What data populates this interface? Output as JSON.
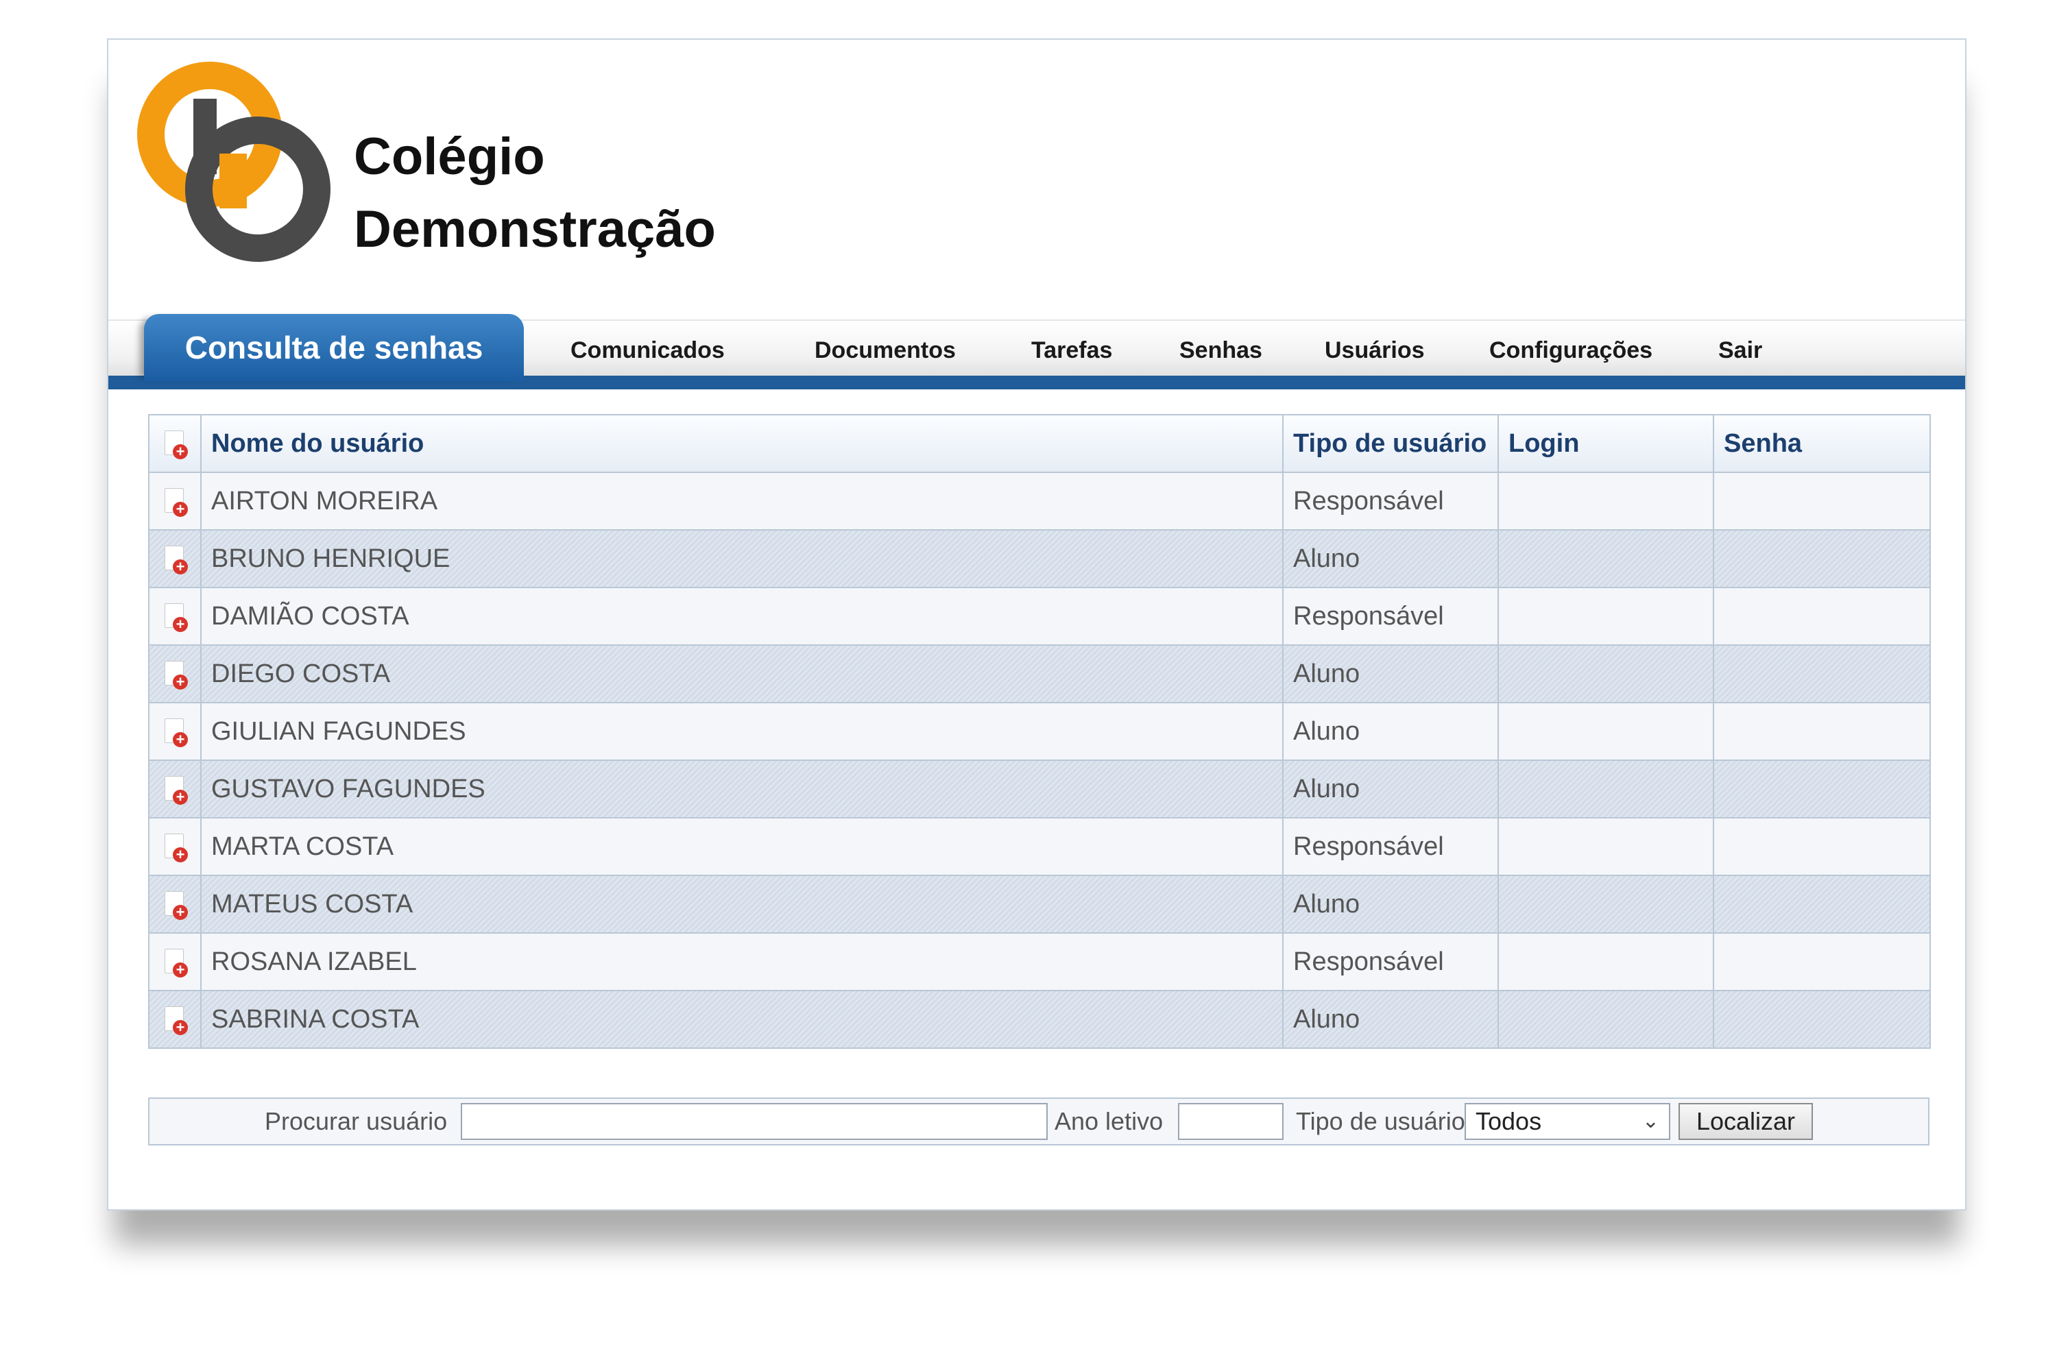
{
  "brand": {
    "line1": "Colégio",
    "line2": "Demonstração"
  },
  "nav": {
    "active": "Consulta de senhas",
    "items": [
      "Comunicados",
      "Documentos",
      "Tarefas",
      "Senhas",
      "Usuários",
      "Configurações",
      "Sair"
    ]
  },
  "table": {
    "headers": [
      "Nome do usuário",
      "Tipo de usuário",
      "Login",
      "Senha"
    ],
    "rows": [
      {
        "name": "AIRTON MOREIRA",
        "type": "Responsável",
        "login": "",
        "senha": ""
      },
      {
        "name": "BRUNO HENRIQUE",
        "type": "Aluno",
        "login": "",
        "senha": ""
      },
      {
        "name": "DAMIÃO COSTA",
        "type": "Responsável",
        "login": "",
        "senha": ""
      },
      {
        "name": "DIEGO COSTA",
        "type": "Aluno",
        "login": "",
        "senha": ""
      },
      {
        "name": "GIULIAN FAGUNDES",
        "type": "Aluno",
        "login": "",
        "senha": ""
      },
      {
        "name": "GUSTAVO FAGUNDES",
        "type": "Aluno",
        "login": "",
        "senha": ""
      },
      {
        "name": "MARTA COSTA",
        "type": "Responsável",
        "login": "",
        "senha": ""
      },
      {
        "name": "MATEUS COSTA",
        "type": "Aluno",
        "login": "",
        "senha": ""
      },
      {
        "name": "ROSANA IZABEL",
        "type": "Responsável",
        "login": "",
        "senha": ""
      },
      {
        "name": "SABRINA COSTA",
        "type": "Aluno",
        "login": "",
        "senha": ""
      }
    ]
  },
  "search": {
    "user_label": "Procurar usuário",
    "user_value": "",
    "year_label": "Ano letivo",
    "year_value": "",
    "type_label": "Tipo de usuário",
    "type_selected": "Todos",
    "button": "Localizar"
  },
  "icons": {
    "row_icon": "add-document-icon",
    "select_icon": "chevron-down-icon"
  },
  "colors": {
    "accent": "#1f5c99",
    "logo_orange": "#f39c12",
    "logo_dark": "#4a4a4a",
    "add_red": "#d8342b"
  }
}
